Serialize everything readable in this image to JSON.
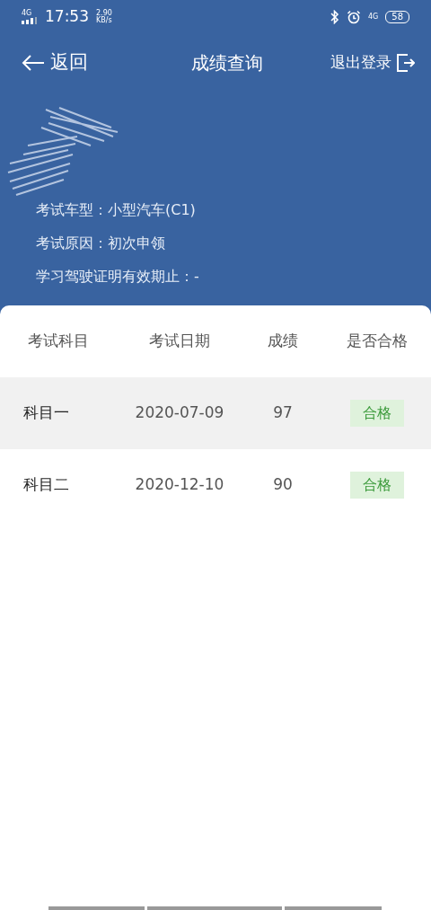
{
  "status_bar": {
    "network": "4G",
    "time": "17:53",
    "speed": "2.90",
    "speed_unit": "KB/s",
    "mobile": "4G",
    "battery": "58"
  },
  "header": {
    "back": "返回",
    "title": "成绩查询",
    "logout": "退出登录"
  },
  "profile": {
    "info": [
      {
        "label": "考试车型：",
        "value": "小型汽车(C1)"
      },
      {
        "label": "考试原因：",
        "value": "初次申领"
      },
      {
        "label": "学习驾驶证明有效期止：",
        "value": "-"
      }
    ]
  },
  "table": {
    "columns": [
      "考试科目",
      "考试日期",
      "成绩",
      "是否合格"
    ],
    "rows": [
      {
        "subject": "科目一",
        "date": "2020-07-09",
        "score": "97",
        "result": "合格",
        "kind": "pass",
        "highlighted": true
      },
      {
        "subject": "科目二",
        "date": "2020-12-10",
        "score": "90",
        "result": "合格",
        "kind": "pass",
        "highlighted": false
      }
    ]
  }
}
